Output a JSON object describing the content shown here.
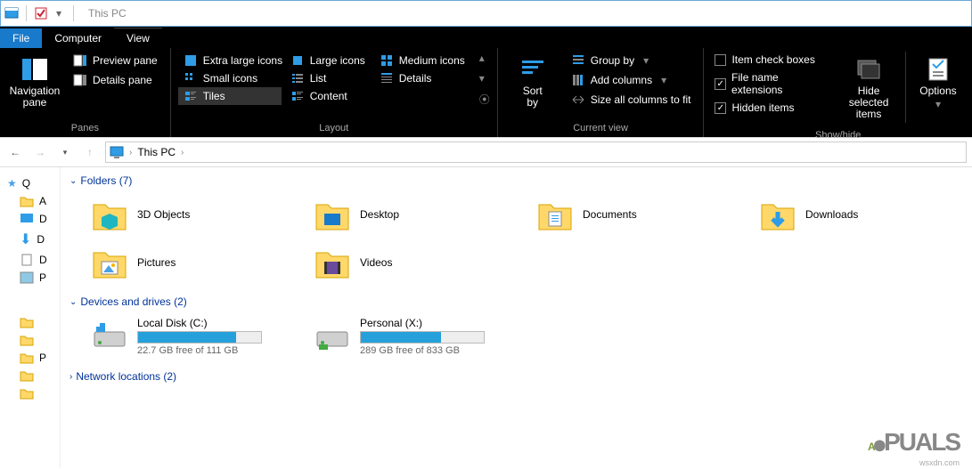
{
  "title": "This PC",
  "tabs": {
    "file": "File",
    "computer": "Computer",
    "view": "View"
  },
  "ribbon": {
    "panes": {
      "title": "Panes",
      "navigation": "Navigation\npane",
      "preview": "Preview pane",
      "details": "Details pane"
    },
    "layout": {
      "title": "Layout",
      "xl": "Extra large icons",
      "large": "Large icons",
      "medium": "Medium icons",
      "small": "Small icons",
      "list": "List",
      "det": "Details",
      "tiles": "Tiles",
      "content": "Content"
    },
    "currentview": {
      "title": "Current view",
      "sortby": "Sort\nby",
      "groupby": "Group by",
      "addcols": "Add columns",
      "sizecols": "Size all columns to fit"
    },
    "showhide": {
      "title": "Show/hide",
      "itemcheck": "Item check boxes",
      "ext": "File name extensions",
      "hidden": "Hidden items",
      "hidesel": "Hide selected\nitems",
      "options": "Options"
    }
  },
  "address": {
    "path": "This PC"
  },
  "sidebar": {
    "quick": "Q",
    "a": "A",
    "d": "D",
    "d2": "D",
    "d3": "D",
    "p": "P",
    "p2": "P"
  },
  "sections": {
    "folders": {
      "label": "Folders (7)"
    },
    "devices": {
      "label": "Devices and drives (2)"
    },
    "network": {
      "label": "Network locations (2)"
    }
  },
  "folders": [
    {
      "name": "3D Objects"
    },
    {
      "name": "Desktop"
    },
    {
      "name": "Documents"
    },
    {
      "name": "Downloads"
    },
    {
      "name": "Pictures"
    },
    {
      "name": "Videos"
    }
  ],
  "drives": [
    {
      "name": "Local Disk (C:)",
      "free": "22.7 GB free of 111 GB",
      "pct": 80
    },
    {
      "name": "Personal (X:)",
      "free": "289 GB free of 833 GB",
      "pct": 65
    }
  ],
  "watermark": "A🅿PUALS",
  "wm_sub": "wsxdn.com"
}
